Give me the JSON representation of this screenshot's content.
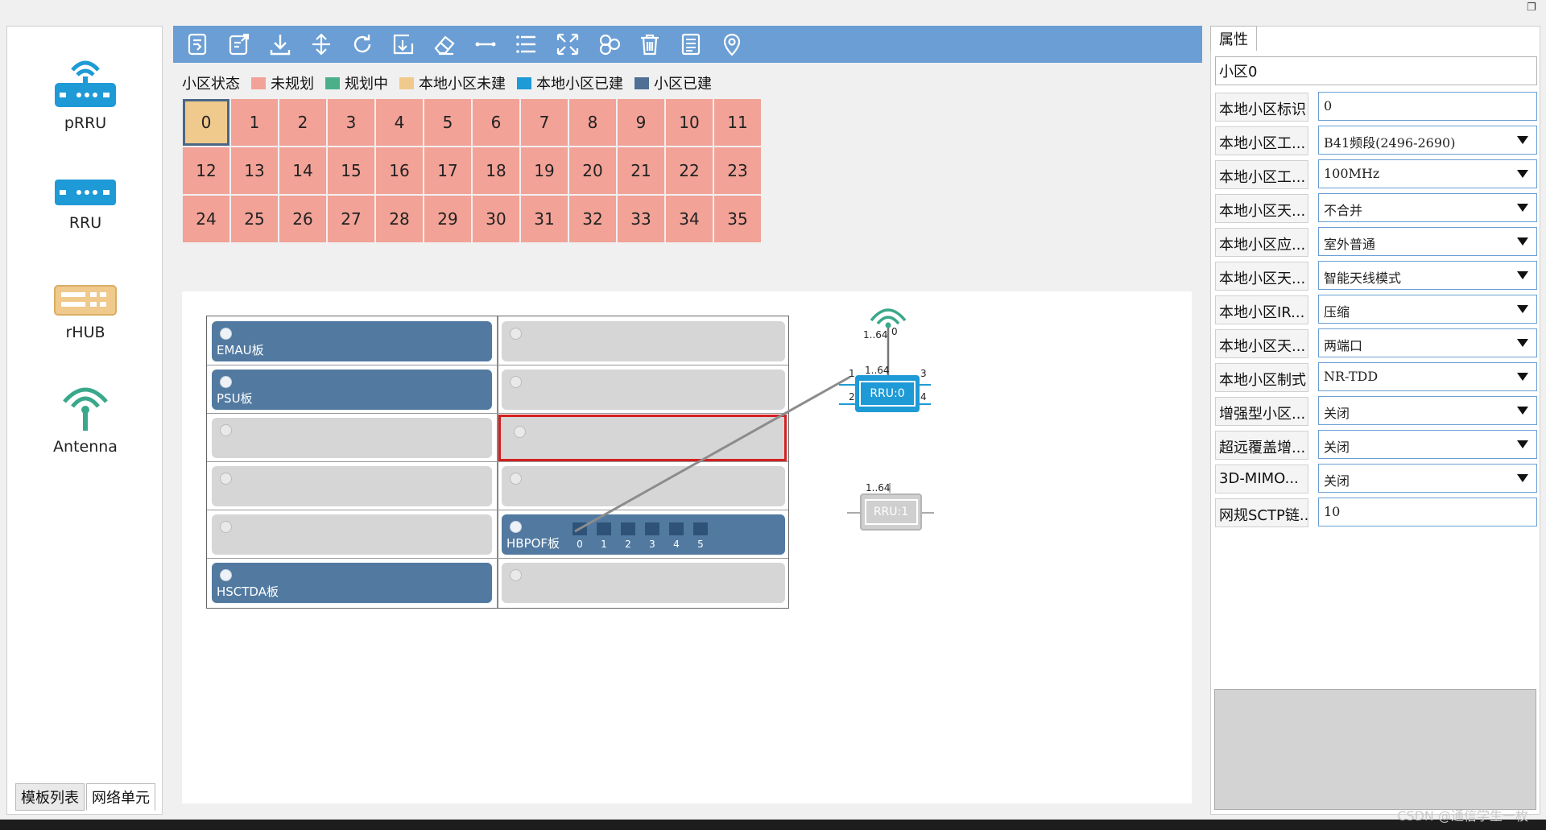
{
  "palette": {
    "items": [
      {
        "label": "pRRU",
        "icon": "prru-icon"
      },
      {
        "label": "RRU",
        "icon": "rru-icon"
      },
      {
        "label": "rHUB",
        "icon": "rhub-icon"
      },
      {
        "label": "Antenna",
        "icon": "antenna-icon"
      }
    ],
    "tabs": [
      "模板列表",
      "网络单元"
    ]
  },
  "toolbar": {
    "icons": [
      "import-config-icon",
      "export-config-icon",
      "download-icon",
      "sync-icon",
      "refresh-icon",
      "apply-icon",
      "eraser-icon",
      "link-icon",
      "list-icon",
      "fit-screen-icon",
      "topology-icon",
      "delete-icon",
      "document-icon",
      "location-icon"
    ]
  },
  "legend": {
    "title": "小区状态",
    "items": [
      {
        "label": "未规划",
        "color": "#f2a297"
      },
      {
        "label": "规划中",
        "color": "#4bb08a"
      },
      {
        "label": "本地小区未建",
        "color": "#f0c98c"
      },
      {
        "label": "本地小区已建",
        "color": "#1e9ad6"
      },
      {
        "label": "小区已建",
        "color": "#4f6f94"
      }
    ]
  },
  "cells": [
    "0",
    "1",
    "2",
    "3",
    "4",
    "5",
    "6",
    "7",
    "8",
    "9",
    "10",
    "11",
    "12",
    "13",
    "14",
    "15",
    "16",
    "17",
    "18",
    "19",
    "20",
    "21",
    "22",
    "23",
    "24",
    "25",
    "26",
    "27",
    "28",
    "29",
    "30",
    "31",
    "32",
    "33",
    "34",
    "35"
  ],
  "rack": {
    "slots": {
      "emau": "EMAU板",
      "psu": "PSU板",
      "hbpof": "HBPOF板",
      "hsctda": "HSCTDA板"
    },
    "ports": [
      "0",
      "1",
      "2",
      "3",
      "4",
      "5"
    ]
  },
  "topology": {
    "antenna_range": "1..64",
    "antenna_port": "0",
    "rru0": {
      "label": "RRU:0",
      "range": "1..64",
      "ports": [
        "1",
        "2",
        "3",
        "4"
      ]
    },
    "rru1": {
      "label": "RRU:1",
      "range": "1..64"
    }
  },
  "properties": {
    "tab": "属性",
    "name": "小区0",
    "rows": [
      {
        "label": "本地小区标识",
        "value": "0",
        "dropdown": false
      },
      {
        "label": "本地小区工...",
        "value": "B41频段(2496-2690)",
        "dropdown": true
      },
      {
        "label": "本地小区工...",
        "value": "100MHz",
        "dropdown": true
      },
      {
        "label": "本地小区天...",
        "value": "不合并",
        "dropdown": true
      },
      {
        "label": "本地小区应...",
        "value": "室外普通",
        "dropdown": true
      },
      {
        "label": "本地小区天...",
        "value": "智能天线模式",
        "dropdown": true
      },
      {
        "label": "本地小区IR...",
        "value": "压缩",
        "dropdown": true
      },
      {
        "label": "本地小区天...",
        "value": "两端口",
        "dropdown": true
      },
      {
        "label": "本地小区制式",
        "value": "NR-TDD",
        "dropdown": true
      },
      {
        "label": "增强型小区...",
        "value": "关闭",
        "dropdown": true
      },
      {
        "label": "超远覆盖增...",
        "value": "关闭",
        "dropdown": true
      },
      {
        "label": "3D-MIMO...",
        "value": "关闭",
        "dropdown": true
      },
      {
        "label": "网规SCTP链...",
        "value": "10",
        "dropdown": false
      }
    ]
  },
  "watermark": "CSDN @通信学生一枚"
}
